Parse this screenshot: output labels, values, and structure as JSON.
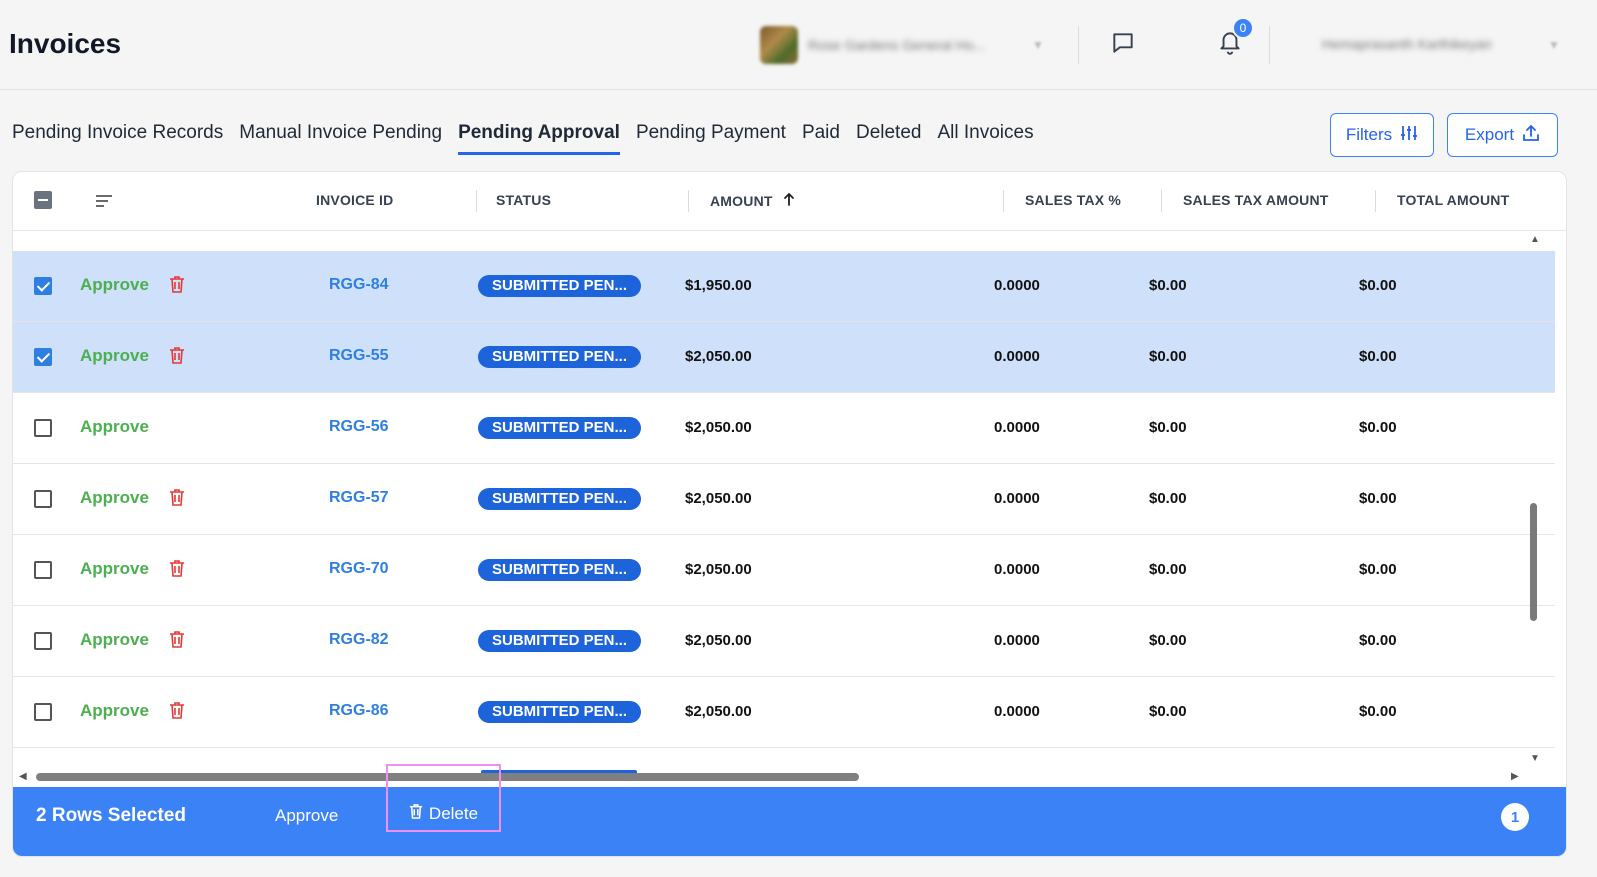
{
  "header": {
    "title": "Invoices",
    "company_name": "Rose Gardens General Ho...",
    "notification_count": "0",
    "user_name": "Hemaprasanth Karthikeyan"
  },
  "tabs": [
    {
      "label": "Pending Invoice Records",
      "active": false
    },
    {
      "label": "Manual Invoice Pending",
      "active": false
    },
    {
      "label": "Pending Approval",
      "active": true
    },
    {
      "label": "Pending Payment",
      "active": false
    },
    {
      "label": "Paid",
      "active": false
    },
    {
      "label": "Deleted",
      "active": false
    },
    {
      "label": "All Invoices",
      "active": false
    }
  ],
  "toolbar": {
    "filters_label": "Filters",
    "export_label": "Export"
  },
  "table": {
    "columns": {
      "invoice_id": "INVOICE ID",
      "status": "STATUS",
      "amount": "AMOUNT",
      "sales_tax_pct": "SALES TAX %",
      "sales_tax_amount": "SALES TAX AMOUNT",
      "total_amount": "TOTAL AMOUNT"
    },
    "approve_label": "Approve",
    "rows": [
      {
        "selected": true,
        "has_delete": true,
        "invoice_id": "RGG-84",
        "status": "SUBMITTED PEN...",
        "amount": "$1,950.00",
        "sales_tax_pct": "0.0000",
        "sales_tax_amount": "$0.00",
        "total_amount": "$0.00"
      },
      {
        "selected": true,
        "has_delete": true,
        "invoice_id": "RGG-55",
        "status": "SUBMITTED PEN...",
        "amount": "$2,050.00",
        "sales_tax_pct": "0.0000",
        "sales_tax_amount": "$0.00",
        "total_amount": "$0.00"
      },
      {
        "selected": false,
        "has_delete": false,
        "invoice_id": "RGG-56",
        "status": "SUBMITTED PEN...",
        "amount": "$2,050.00",
        "sales_tax_pct": "0.0000",
        "sales_tax_amount": "$0.00",
        "total_amount": "$0.00"
      },
      {
        "selected": false,
        "has_delete": true,
        "invoice_id": "RGG-57",
        "status": "SUBMITTED PEN...",
        "amount": "$2,050.00",
        "sales_tax_pct": "0.0000",
        "sales_tax_amount": "$0.00",
        "total_amount": "$0.00"
      },
      {
        "selected": false,
        "has_delete": true,
        "invoice_id": "RGG-70",
        "status": "SUBMITTED PEN...",
        "amount": "$2,050.00",
        "sales_tax_pct": "0.0000",
        "sales_tax_amount": "$0.00",
        "total_amount": "$0.00"
      },
      {
        "selected": false,
        "has_delete": true,
        "invoice_id": "RGG-82",
        "status": "SUBMITTED PEN...",
        "amount": "$2,050.00",
        "sales_tax_pct": "0.0000",
        "sales_tax_amount": "$0.00",
        "total_amount": "$0.00"
      },
      {
        "selected": false,
        "has_delete": true,
        "invoice_id": "RGG-86",
        "status": "SUBMITTED PEN...",
        "amount": "$2,050.00",
        "sales_tax_pct": "0.0000",
        "sales_tax_amount": "$0.00",
        "total_amount": "$0.00"
      }
    ]
  },
  "action_bar": {
    "selected_text": "2 Rows Selected",
    "approve_label": "Approve",
    "delete_label": "Delete",
    "page_badge": "1"
  },
  "colors": {
    "accent": "#3b82f6",
    "approve_green": "#4caf50",
    "delete_red": "#e53935",
    "selected_row": "#cfe0fb",
    "status_pill": "#1d63d9"
  }
}
